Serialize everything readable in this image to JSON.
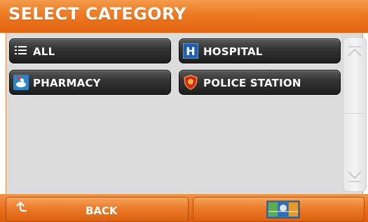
{
  "header": {
    "title": "SELECT CATEGORY"
  },
  "categories": [
    {
      "label": "ALL",
      "icon": "list-icon"
    },
    {
      "label": "HOSPITAL",
      "icon": "hospital-icon"
    },
    {
      "label": "PHARMACY",
      "icon": "pharmacy-icon"
    },
    {
      "label": "POLICE STATION",
      "icon": "police-badge-icon"
    }
  ],
  "footer": {
    "back_label": "BACK",
    "map_icon": "map-icon"
  },
  "colors": {
    "header_orange": "#ee7a22",
    "button_dark": "#353535",
    "panel_gray": "#dcdcdc",
    "hospital_blue": "#1f5fb0",
    "police_red": "#d6261c"
  }
}
